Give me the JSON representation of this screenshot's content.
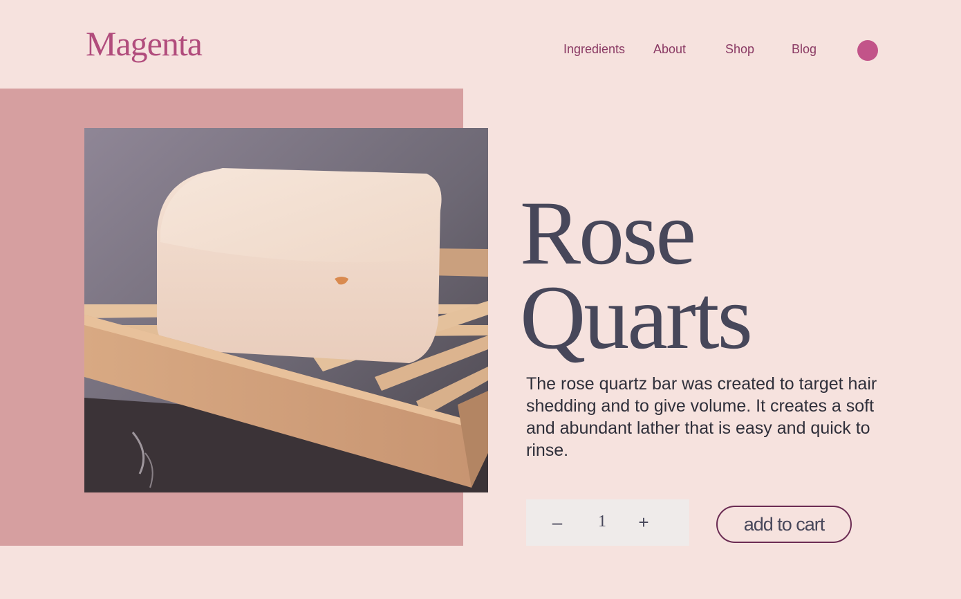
{
  "brand": {
    "logo_text": "Magenta"
  },
  "nav": {
    "items": [
      {
        "label": "Ingredients"
      },
      {
        "label": "About"
      },
      {
        "label": "Shop"
      },
      {
        "label": "Blog"
      }
    ]
  },
  "product": {
    "title_line1": "Rose",
    "title_line2": "Quarts",
    "description": "The rose quartz bar was created to target hair shedding and to give volume. It creates a soft and abundant lather that is easy and quick to rinse.",
    "quantity": "1",
    "decrement_symbol": "–",
    "increment_symbol": "+",
    "add_to_cart_label": "add to cart"
  },
  "colors": {
    "background": "#f6e2de",
    "accent": "#c25489",
    "logo": "#b14c7c",
    "backdrop": "#d69fa0",
    "text_dark": "#47475a",
    "button_border": "#6b2c53"
  },
  "icons": {
    "avatar": "user-avatar-circle"
  }
}
